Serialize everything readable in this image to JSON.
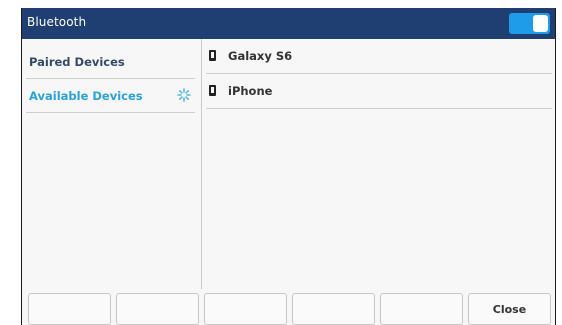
{
  "header": {
    "title": "Bluetooth",
    "toggle_state": "on",
    "accent_color": "#1e9be9",
    "bar_color": "#1f3f73"
  },
  "sidebar": {
    "items": [
      {
        "label": "Paired Devices",
        "color": "#334a6b"
      },
      {
        "label": "Available Devices",
        "color": "#2aa3e0",
        "icon": "loading-spinner-icon"
      }
    ]
  },
  "devices": [
    {
      "name": "Galaxy S6",
      "icon": "phone-icon"
    },
    {
      "name": "iPhone",
      "icon": "phone-icon"
    }
  ],
  "softkeys": [
    "",
    "",
    "",
    "",
    "",
    "Close"
  ]
}
